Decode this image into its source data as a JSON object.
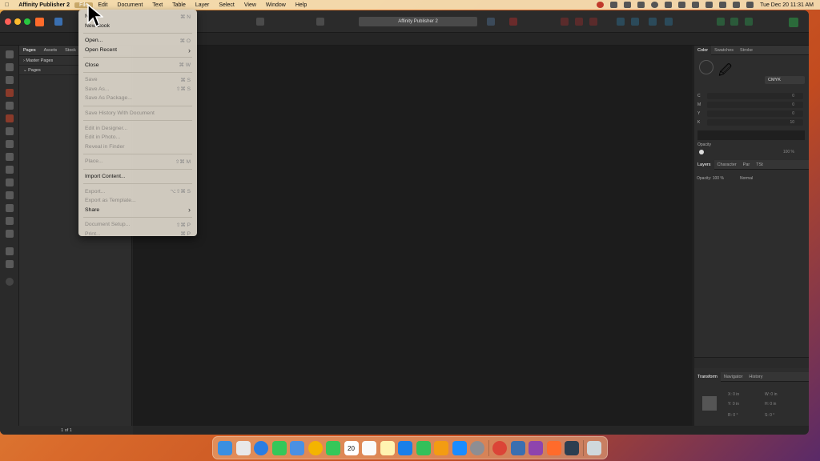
{
  "menubar": {
    "apple": "",
    "app_name": "Affinity Publisher 2",
    "items": [
      "File",
      "Edit",
      "Document",
      "Text",
      "Table",
      "Layer",
      "Select",
      "View",
      "Window",
      "Help"
    ],
    "clock": "Tue Dec 20  11:31 AM"
  },
  "window": {
    "title": "Affinity Publisher 2"
  },
  "file_menu": {
    "items": [
      {
        "label": "New...",
        "shortcut": "⌘ N",
        "enabled": true
      },
      {
        "label": "New Book",
        "shortcut": "",
        "enabled": true
      },
      {
        "sep": true
      },
      {
        "label": "Open...",
        "shortcut": "⌘ O",
        "enabled": true
      },
      {
        "label": "Open Recent",
        "shortcut": "›",
        "enabled": true
      },
      {
        "sep": true
      },
      {
        "label": "Close",
        "shortcut": "⌘ W",
        "enabled": true
      },
      {
        "sep": true
      },
      {
        "label": "Save",
        "shortcut": "⌘ S",
        "enabled": false
      },
      {
        "label": "Save As...",
        "shortcut": "⇧⌘ S",
        "enabled": false
      },
      {
        "label": "Save As Package...",
        "shortcut": "",
        "enabled": false
      },
      {
        "sep": true
      },
      {
        "label": "Save History With Document",
        "shortcut": "",
        "enabled": false
      },
      {
        "sep": true
      },
      {
        "label": "Edit in Designer...",
        "shortcut": "",
        "enabled": false
      },
      {
        "label": "Edit in Photo...",
        "shortcut": "",
        "enabled": false
      },
      {
        "label": "Reveal in Finder",
        "shortcut": "",
        "enabled": false
      },
      {
        "sep": true
      },
      {
        "label": "Place...",
        "shortcut": "⇧⌘ M",
        "enabled": false
      },
      {
        "sep": true
      },
      {
        "label": "Import Content...",
        "shortcut": "",
        "enabled": true
      },
      {
        "sep": true
      },
      {
        "label": "Export...",
        "shortcut": "⌥⇧⌘ S",
        "enabled": false
      },
      {
        "label": "Export as Template...",
        "shortcut": "",
        "enabled": false
      },
      {
        "label": "Share",
        "shortcut": "›",
        "enabled": true
      },
      {
        "sep": true
      },
      {
        "label": "Document Setup...",
        "shortcut": "⇧⌘ P",
        "enabled": false
      },
      {
        "label": "Print...",
        "shortcut": "⌘ P",
        "enabled": false
      }
    ]
  },
  "left_panel": {
    "tabs": [
      "Pages",
      "Assets",
      "Stock"
    ],
    "master_pages": "Master Pages",
    "pages": "Pages",
    "page_status": "1 of 1"
  },
  "color_panel": {
    "tabs": [
      "Color",
      "Swatches",
      "Stroke"
    ],
    "mode": "CMYK",
    "channels": [
      {
        "label": "C",
        "value": "0"
      },
      {
        "label": "M",
        "value": "0"
      },
      {
        "label": "Y",
        "value": "0"
      },
      {
        "label": "K",
        "value": "10"
      }
    ],
    "opacity_label": "Opacity",
    "opacity_value": "100 %"
  },
  "layers_panel": {
    "tabs": [
      "Layers",
      "Character",
      "Par",
      "TSt"
    ],
    "opacity": "Opacity:  100 %",
    "blend": "Normal"
  },
  "transform_panel": {
    "tabs": [
      "Transform",
      "Navigator",
      "History"
    ],
    "x": "X:  0 in",
    "y": "Y:  0 in",
    "w": "W:  0 in",
    "h": "H:  0 in",
    "r": "R:  0 °",
    "s": "S:  0 °"
  },
  "calendar_day": "20",
  "colors": {
    "accent": "#ff6b2b",
    "menu_bg": "#d6d0c4"
  }
}
